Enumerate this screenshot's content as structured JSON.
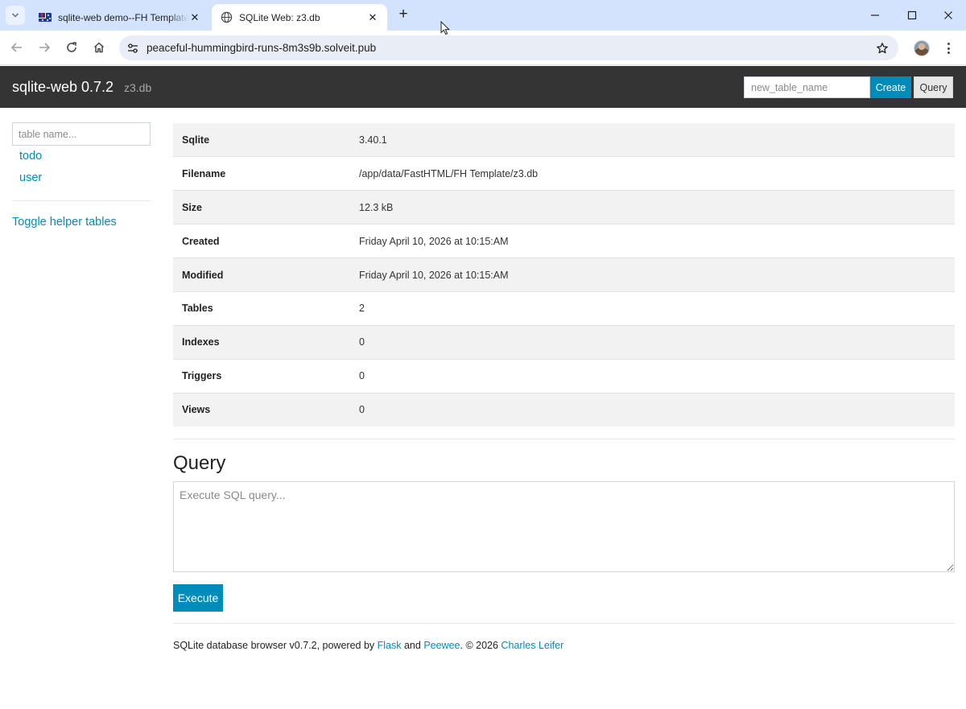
{
  "browser": {
    "tabs": [
      {
        "title": "sqlite-web demo--FH Template",
        "active": false
      },
      {
        "title": "SQLite Web: z3.db",
        "active": true
      }
    ],
    "url": "peaceful-hummingbird-runs-8m3s9b.solveit.pub"
  },
  "navbar": {
    "brand": "sqlite-web 0.7.2",
    "db_name": "z3.db",
    "new_table_placeholder": "new_table_name",
    "create_label": "Create",
    "query_label": "Query"
  },
  "sidebar": {
    "search_placeholder": "table name...",
    "tables": [
      "todo",
      "user"
    ],
    "toggle_label": "Toggle helper tables"
  },
  "info": {
    "rows": [
      {
        "key": "Sqlite",
        "value": "3.40.1"
      },
      {
        "key": "Filename",
        "value": "/app/data/FastHTML/FH Template/z3.db"
      },
      {
        "key": "Size",
        "value": "12.3 kB"
      },
      {
        "key": "Created",
        "value": "Friday April 10, 2026 at 10:15:AM"
      },
      {
        "key": "Modified",
        "value": "Friday April 10, 2026 at 10:15:AM"
      },
      {
        "key": "Tables",
        "value": "2"
      },
      {
        "key": "Indexes",
        "value": "0"
      },
      {
        "key": "Triggers",
        "value": "0"
      },
      {
        "key": "Views",
        "value": "0"
      }
    ]
  },
  "query": {
    "heading": "Query",
    "placeholder": "Execute SQL query...",
    "execute_label": "Execute"
  },
  "footer": {
    "prefix": "SQLite database browser v0.7.2, powered by ",
    "flask": "Flask",
    "and": " and ",
    "peewee": "Peewee",
    "copyright": ". © 2026 ",
    "author": "Charles Leifer"
  },
  "colors": {
    "accent": "#008cba",
    "navbar": "#343434",
    "tabstrip": "#d3e3fd"
  }
}
